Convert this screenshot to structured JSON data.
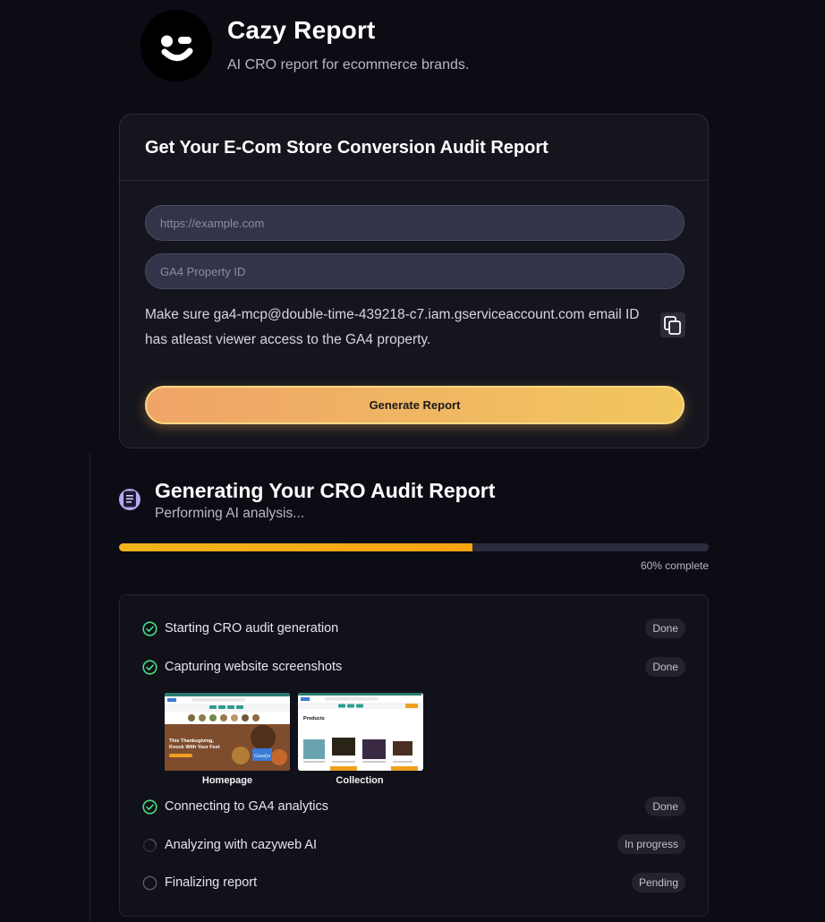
{
  "header": {
    "title": "Cazy Report",
    "subtitle": "AI CRO report for ecommerce brands."
  },
  "form": {
    "title": "Get Your E-Com Store Conversion Audit Report",
    "url_placeholder": "https://example.com",
    "ga4_placeholder": "GA4 Property ID",
    "hint": "Make sure ga4-mcp@double-time-439218-c7.iam.gserviceaccount.com email ID has atleast viewer access to the GA4 property.",
    "button_label": "Generate Report"
  },
  "progress": {
    "title": "Generating Your CRO Audit Report",
    "subtitle": "Performing AI analysis...",
    "percent": 60,
    "label": "60% complete"
  },
  "steps": [
    {
      "label": "Starting CRO audit generation",
      "status": "Done",
      "state": "done"
    },
    {
      "label": "Capturing website screenshots",
      "status": "Done",
      "state": "done"
    },
    {
      "label": "Connecting to GA4 analytics",
      "status": "Done",
      "state": "done"
    },
    {
      "label": "Analyzing with cazyweb AI",
      "status": "In progress",
      "state": "progress"
    },
    {
      "label": "Finalizing report",
      "status": "Pending",
      "state": "pending"
    }
  ],
  "screenshots": [
    {
      "caption": "Homepage",
      "banner": "This Thanksgiving, Knock With Your Feet",
      "badge": "Goodys"
    },
    {
      "caption": "Collection",
      "heading": "Products",
      "logo": "Goodys"
    }
  ],
  "colors": {
    "accent_progress": "#f2b31c",
    "check_green": "#4ade80",
    "button_gradient_start": "#f0a468",
    "button_gradient_end": "#f1c75d"
  }
}
